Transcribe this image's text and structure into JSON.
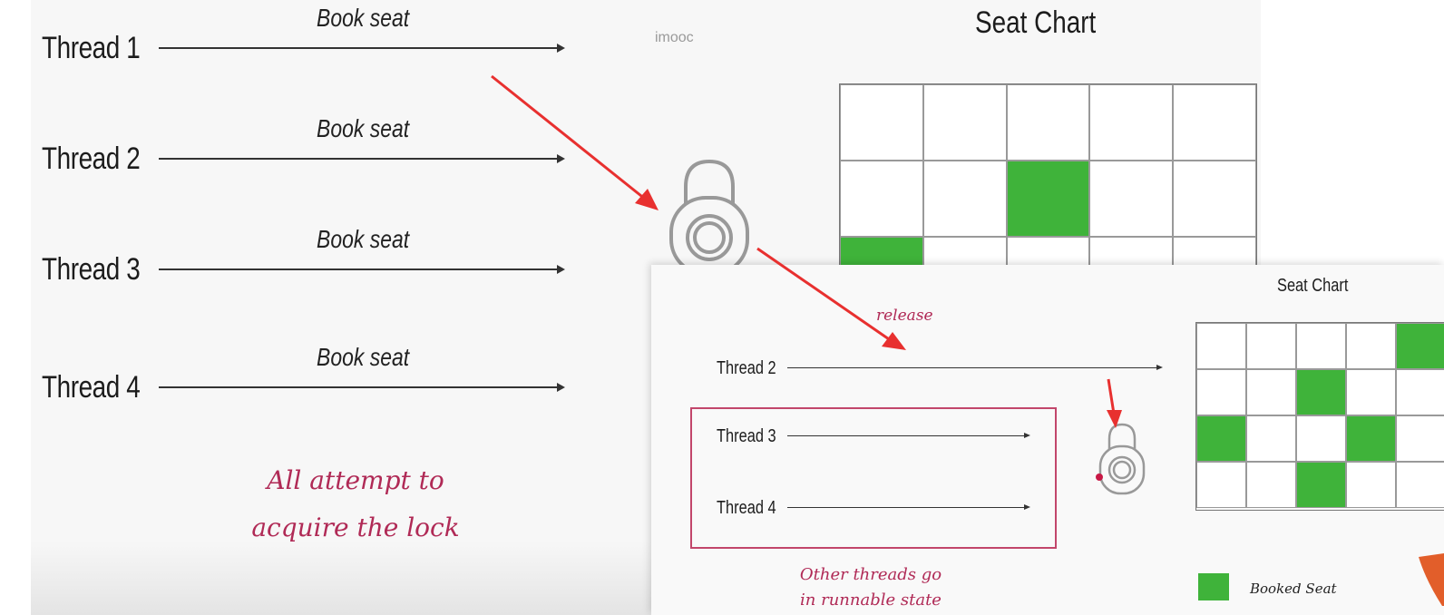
{
  "main_diagram": {
    "threads": [
      {
        "label": "Thread 1",
        "action": "Book seat"
      },
      {
        "label": "Thread 2",
        "action": "Book seat"
      },
      {
        "label": "Thread 3",
        "action": "Book seat"
      },
      {
        "label": "Thread 4",
        "action": "Book seat"
      }
    ],
    "note_line1": "All attempt to",
    "note_line2": "acquire the lock",
    "watermark": "imooc",
    "seat_chart": {
      "title": "Seat Chart",
      "rows": [
        [
          false,
          false,
          false,
          false,
          false
        ],
        [
          false,
          false,
          true,
          false,
          false
        ],
        [
          true,
          false,
          false,
          false,
          false
        ]
      ]
    }
  },
  "inset_diagram": {
    "release_label": "release",
    "threads": [
      {
        "label": "Thread 2"
      },
      {
        "label": "Thread 3"
      },
      {
        "label": "Thread 4"
      }
    ],
    "runnable_line1": "Other threads go",
    "runnable_line2": "in runnable state",
    "seat_chart": {
      "title": "Seat Chart",
      "rows": [
        [
          false,
          false,
          false,
          false,
          true
        ],
        [
          false,
          false,
          true,
          false,
          false
        ],
        [
          true,
          false,
          false,
          true,
          false
        ],
        [
          false,
          false,
          true,
          false,
          false
        ]
      ]
    },
    "legend": {
      "booked_label": "Booked Seat"
    }
  },
  "colors": {
    "booked": "#3fb33a",
    "accent_pink": "#b02a56",
    "pointer_red": "#e8302f"
  }
}
